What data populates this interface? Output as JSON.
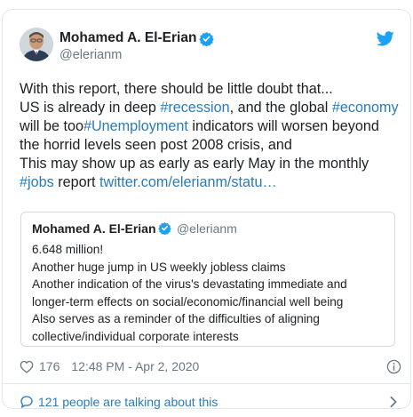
{
  "tweet": {
    "author_name": "Mohamed A. El-Erian",
    "author_handle": "@elerianm",
    "text_lines": [
      [
        {
          "t": "With this report, there should be little doubt that...",
          "link": false
        }
      ],
      [
        {
          "t": "US is already in deep ",
          "link": false
        },
        {
          "t": "#recession",
          "link": true
        },
        {
          "t": ", and the global ",
          "link": false
        },
        {
          "t": "#economy",
          "link": true
        }
      ],
      [
        {
          "t": "will be too",
          "link": false
        },
        {
          "t": "#Unemployment",
          "link": true
        },
        {
          "t": " indicators will worsen beyond",
          "link": false
        }
      ],
      [
        {
          "t": "the horrid levels seen post 2008 crisis, and",
          "link": false
        }
      ],
      [
        {
          "t": "This may show up as early as early May in the monthly",
          "link": false
        }
      ],
      [
        {
          "t": "#jobs",
          "link": true
        },
        {
          "t": " report ",
          "link": false
        },
        {
          "t": "twitter.com/elerianm/statu…",
          "link": true
        }
      ]
    ],
    "quoted": {
      "author_name": "Mohamed A. El-Erian",
      "author_handle": "@elerianm",
      "lines": [
        "6.648 million!",
        "Another huge jump in US weekly jobless claims",
        "Another indication of the virus's devastating immediate and",
        "longer-term effects on social/economic/financial well being",
        "Also serves as a reminder of the difficulties of aligning",
        "collective/individual corporate interests"
      ]
    },
    "likes": "176",
    "timestamp": "12:48 PM - Apr 2, 2020",
    "talking_about": "121 people are talking about this"
  },
  "icons": {
    "verified": "verified-badge-icon",
    "bird": "twitter-bird-icon",
    "heart": "heart-icon",
    "info": "info-icon",
    "reply": "reply-bubble-icon",
    "chevron": "chevron-right-icon"
  },
  "colors": {
    "link": "#2b7bb9",
    "twitter_blue": "#1da1f2",
    "muted": "#697882",
    "text": "#1c2022",
    "border": "#e1e8ed"
  }
}
